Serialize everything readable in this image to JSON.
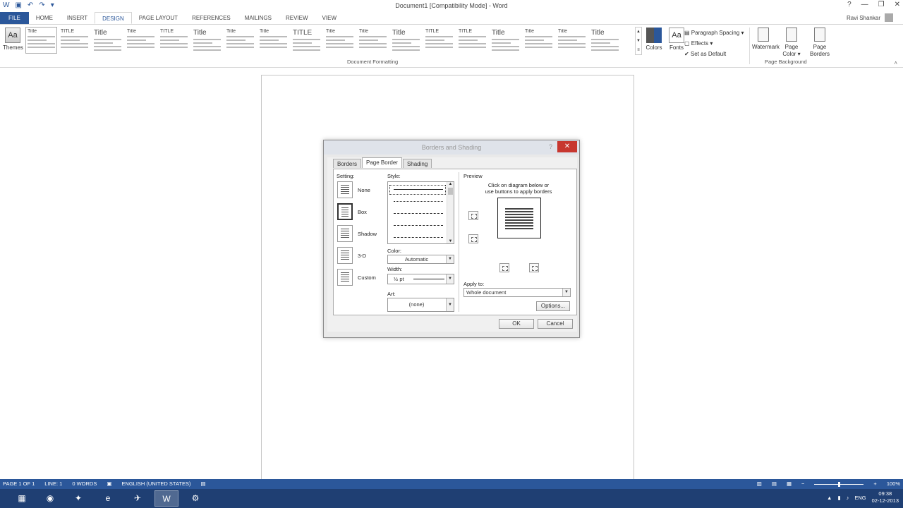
{
  "window": {
    "title": "Document1 [Compatibility Mode] - Word",
    "user_name": "Ravi Shankar",
    "help": "?",
    "minimize": "—",
    "maximize": "❐",
    "close": "✕"
  },
  "qat": {
    "word_icon": "W",
    "save": "▣",
    "undo": "↶",
    "redo": "↷",
    "customize": "▾"
  },
  "tabs": [
    {
      "label": "FILE"
    },
    {
      "label": "HOME"
    },
    {
      "label": "INSERT"
    },
    {
      "label": "DESIGN"
    },
    {
      "label": "PAGE LAYOUT"
    },
    {
      "label": "REFERENCES"
    },
    {
      "label": "MAILINGS"
    },
    {
      "label": "REVIEW"
    },
    {
      "label": "VIEW"
    }
  ],
  "ribbon": {
    "themes_label": "Themes",
    "themes_icon": "Aa",
    "style_thumbs": [
      {
        "title": "Title"
      },
      {
        "title": "TITLE"
      },
      {
        "title": "Title"
      },
      {
        "title": "Title"
      },
      {
        "title": "TITLE"
      },
      {
        "title": "Title"
      },
      {
        "title": "Title"
      },
      {
        "title": "Title"
      },
      {
        "title": "TITLE"
      },
      {
        "title": "Title"
      },
      {
        "title": "Title"
      },
      {
        "title": "Title"
      },
      {
        "title": "TITLE"
      },
      {
        "title": "TITLE"
      },
      {
        "title": "Title"
      },
      {
        "title": "Title"
      },
      {
        "title": "Title"
      },
      {
        "title": "Title"
      }
    ],
    "document_formatting_label": "Document Formatting",
    "colors_label": "Colors",
    "fonts_label": "Fonts",
    "fonts_icon": "Aa",
    "paragraph_spacing_label": "Paragraph Spacing ▾",
    "effects_label": "Effects ▾",
    "set_default_label": "Set as Default",
    "watermark_label": "Watermark",
    "page_color_label": "Page Color ▾",
    "page_borders_label": "Page Borders",
    "page_background_label": "Page Background",
    "collapse_icon": "˄"
  },
  "dialog": {
    "title": "Borders and Shading",
    "help": "?",
    "close": "✕",
    "tabs": [
      {
        "label": "Borders"
      },
      {
        "label": "Page Border"
      },
      {
        "label": "Shading"
      }
    ],
    "setting_label": "Setting:",
    "settings": [
      {
        "label": "None"
      },
      {
        "label": "Box"
      },
      {
        "label": "Shadow"
      },
      {
        "label": "3-D"
      },
      {
        "label": "Custom"
      }
    ],
    "style_label": "Style:",
    "color_label": "Color:",
    "color_value": "Automatic",
    "width_label": "Width:",
    "width_value": "½ pt",
    "art_label": "Art:",
    "art_value": "(none)",
    "preview_label": "Preview",
    "preview_hint_1": "Click on diagram below or",
    "preview_hint_2": "use buttons to apply borders",
    "apply_to_label": "Apply to:",
    "apply_to_value": "Whole document",
    "options_button": "Options...",
    "ok_button": "OK",
    "cancel_button": "Cancel"
  },
  "status": {
    "page": "PAGE 1 OF 1",
    "line": "LINE: 1",
    "words": "0 WORDS",
    "language": "ENGLISH (UNITED STATES)",
    "zoom": "100%",
    "zoom_fraction": 0.5
  },
  "taskbar": {
    "items": [
      {
        "icon": "▦"
      },
      {
        "icon": "◉"
      },
      {
        "icon": "✦"
      },
      {
        "icon": "e"
      },
      {
        "icon": "✈"
      },
      {
        "icon": "W"
      },
      {
        "icon": "⚙"
      }
    ],
    "lang": "ENG",
    "time": "09:38",
    "date": "02-12-2013"
  }
}
